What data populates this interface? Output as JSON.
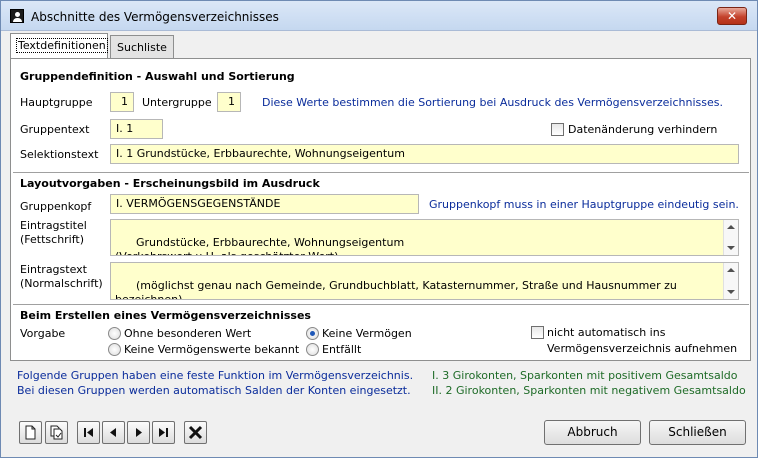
{
  "window": {
    "title": "Abschnitte des Vermögensverzeichnisses",
    "close_label": "✕"
  },
  "tabs": [
    {
      "label": "Textdefinitionen",
      "active": true
    },
    {
      "label": "Suchliste",
      "active": false
    }
  ],
  "gruppendefinition": {
    "heading": "Gruppendefinition - Auswahl und Sortierung",
    "hauptgruppe_label": "Hauptgruppe",
    "hauptgruppe_value": "1",
    "untergruppe_label": "Untergruppe",
    "untergruppe_value": "1",
    "sort_hint": "Diese Werte bestimmen die Sortierung bei Ausdruck des Vermögensverzeichnisses.",
    "gruppentext_label": "Gruppentext",
    "gruppentext_value": "I. 1",
    "datenaenderung_label": "Datenänderung verhindern",
    "selektionstext_label": "Selektionstext",
    "selektionstext_value": "I. 1  Grundstücke, Erbbaurechte, Wohnungseigentum"
  },
  "layout": {
    "heading": "Layoutvorgaben - Erscheinungsbild im Ausdruck",
    "gruppenkopf_label": "Gruppenkopf",
    "gruppenkopf_value": "I. VERMÖGENSGEGENSTÄNDE",
    "gruppenkopf_hint": "Gruppenkopf muss in einer Hauptgruppe eindeutig sein.",
    "eintragstitel_label1": "Eintragstitel",
    "eintragstitel_label2": "(Fettschrift)",
    "eintragstitel_value": "Grundstücke, Erbbaurechte, Wohnungseigentum\n(Verkehrswert u.U. als geschätzter Wert)",
    "eintragstext_label1": "Eintragstext",
    "eintragstext_label2": "(Normalschrift)",
    "eintragstext_value": "(möglichst genau nach Gemeinde, Grundbuchblatt, Katasternummer, Straße und Hausnummer zu bezeichnen)"
  },
  "erstellen": {
    "heading": "Beim Erstellen eines Vermögensverzeichnisses",
    "vorgabe_label": "Vorgabe",
    "options": [
      {
        "label": "Ohne besonderen Wert",
        "checked": false
      },
      {
        "label": "Keine Vermögen",
        "checked": true
      },
      {
        "label": "Keine Vermögenswerte bekannt",
        "checked": false
      },
      {
        "label": "Entfällt",
        "checked": false
      }
    ],
    "auto_label1": "nicht automatisch ins",
    "auto_label2": "Vermögensverzeichnis aufnehmen"
  },
  "info": {
    "line1": "Folgende Gruppen haben eine feste Funktion im Vermögensverzeichnis.",
    "line2": "Bei diesen Gruppen werden automatisch Salden der Konten eingesetzt.",
    "right1": "I. 3 Girokonten, Sparkonten mit positivem Gesamtsaldo",
    "right2": "II. 2 Girokonten, Sparkonten mit negativem Gesamtsaldo"
  },
  "buttons": {
    "abbruch": "Abbruch",
    "schliessen": "Schließen"
  }
}
